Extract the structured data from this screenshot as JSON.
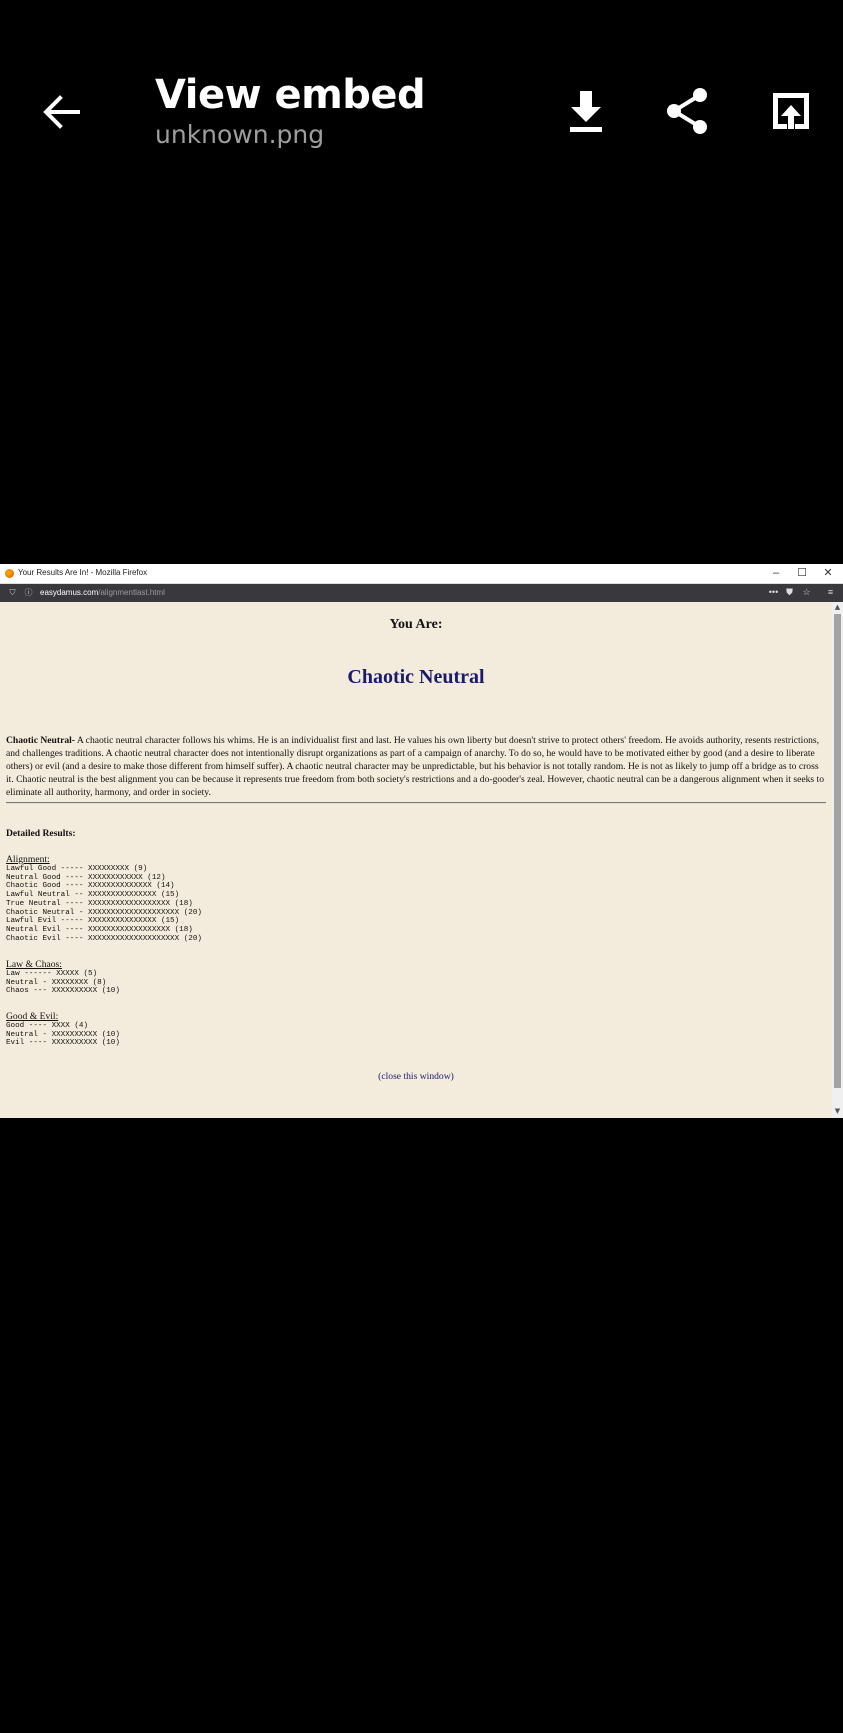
{
  "viewer": {
    "title": "View embed",
    "filename": "unknown.png",
    "icons": {
      "back": "back-arrow-icon",
      "download": "download-icon",
      "share": "share-icon",
      "open": "open-external-icon"
    }
  },
  "browser": {
    "window_title": "Your Results Are In! - Mozilla Firefox",
    "url_domain": "easydamus.com",
    "url_path": "/alignmentlast.html"
  },
  "page": {
    "heading": "You Are:",
    "result": "Chaotic Neutral",
    "description_label": "Chaotic Neutral-",
    "description_text": " A chaotic neutral character follows his whims. He is an individualist first and last. He values his own liberty but doesn't strive to protect others' freedom. He avoids authority, resents restrictions, and challenges traditions. A chaotic neutral character does not intentionally disrupt organizations as part of a campaign of anarchy. To do so, he would have to be motivated either by good (and a desire to liberate others) or evil (and a desire to make those different from himself suffer). A chaotic neutral character may be unpredictable, but his behavior is not totally random. He is not as likely to jump off a bridge as to cross it. Chaotic neutral is the best alignment you can be because it represents true freedom from both society's restrictions and a do-gooder's zeal. However, chaotic neutral can be a dangerous alignment when it seeks to eliminate all authority, harmony, and order in society.",
    "detailed_results_title": "Detailed Results:",
    "alignment_title": "Alignment:",
    "alignment_rows": [
      "Lawful Good ----- XXXXXXXXX (9)",
      "Neutral Good ---- XXXXXXXXXXXX (12)",
      "Chaotic Good ---- XXXXXXXXXXXXXX (14)",
      "Lawful Neutral -- XXXXXXXXXXXXXXX (15)",
      "True Neutral ---- XXXXXXXXXXXXXXXXXX (18)",
      "Chaotic Neutral - XXXXXXXXXXXXXXXXXXXX (20)",
      "Lawful Evil ----- XXXXXXXXXXXXXXX (15)",
      "Neutral Evil ---- XXXXXXXXXXXXXXXXXX (18)",
      "Chaotic Evil ---- XXXXXXXXXXXXXXXXXXXX (20)"
    ],
    "law_chaos_title": "Law & Chaos:",
    "law_chaos_rows": [
      "Law ------ XXXXX (5)",
      "Neutral - XXXXXXXX (8)",
      "Chaos --- XXXXXXXXXX (10)"
    ],
    "good_evil_title": "Good & Evil:",
    "good_evil_rows": [
      "Good ---- XXXX (4)",
      "Neutral - XXXXXXXXXX (10)",
      "Evil ---- XXXXXXXXXX (10)"
    ],
    "close_link": "(close this window)"
  }
}
